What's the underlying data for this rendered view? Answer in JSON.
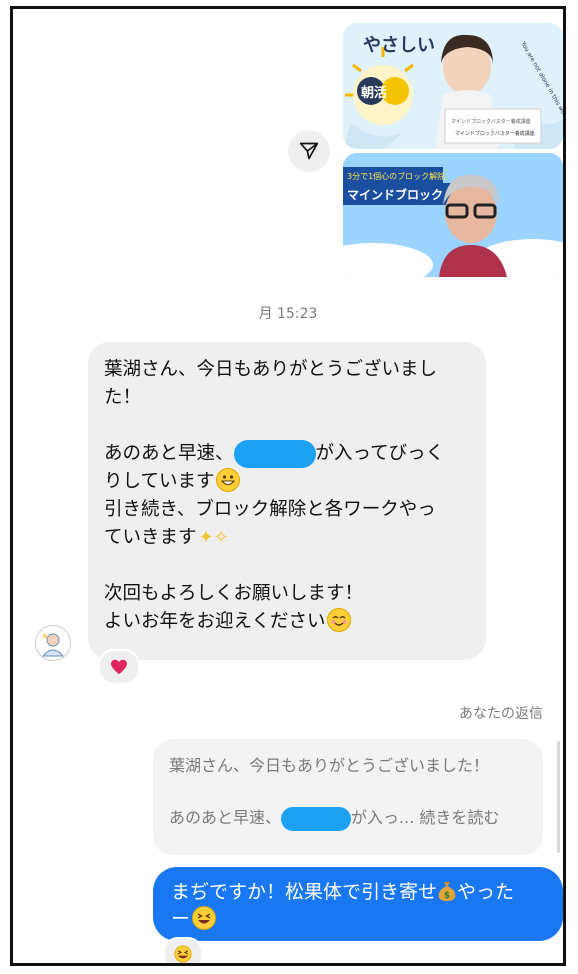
{
  "media": {
    "top_thumb": {
      "title_text": "やさしい",
      "badge_text": "朝活",
      "arc_text": "You are not alone in this world",
      "card_line1": "マインドブロックバスター養成講座",
      "card_line2": "マインドブロックバスター養成講座"
    },
    "bottom_thumb": {
      "caption_top": "3分で1個心のブロック解除",
      "caption_main": "マインドブロック"
    }
  },
  "timestamp": "月 15:23",
  "incoming": {
    "lines": [
      "葉湖さん、今日もありがとうございまし",
      "た！",
      "あのあと早速、",
      "が入ってびっく",
      "りしています",
      "引き続き、ブロック解除と各ワークやっ",
      "ていきます",
      "次回もよろしくお願いします！",
      "よいお年をお迎えください"
    ]
  },
  "reply": {
    "label": "あなたの返信",
    "preview_line1": "葉湖さん、今日もありがとうございました！",
    "preview_line2_start": "あのあと早速、",
    "preview_line2_end": "が入っ... 続きを読む"
  },
  "outgoing": {
    "part1": "まぢですか！松果体で引き寄せ",
    "part2": "やった",
    "part3": "ー"
  },
  "colors": {
    "outgoing_bubble": "#1977f2",
    "incoming_bubble": "#efefef",
    "redaction": "#1da1f2"
  }
}
